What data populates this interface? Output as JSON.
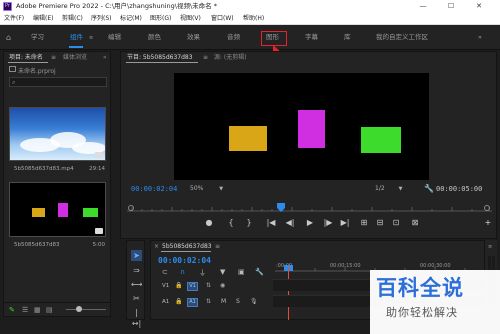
{
  "titlebar": {
    "app_logo": "Pr",
    "title": "Adobe Premiere Pro 2022 - C:\\用户\\zhangshuning\\视频\\未命名 *",
    "minimize": "—",
    "maximize": "☐",
    "close": "✕"
  },
  "menubar": {
    "items": [
      "文件(F)",
      "编辑(E)",
      "剪辑(C)",
      "序列(S)",
      "标记(M)",
      "图形(G)",
      "视图(V)",
      "窗口(W)",
      "帮助(H)"
    ]
  },
  "workspaces": {
    "tabs": [
      "学习",
      "组件",
      "编辑",
      "颜色",
      "效果",
      "音频",
      "图形",
      "字幕",
      "库",
      "我的自定义工作区"
    ],
    "active_index": 1,
    "highlighted_index": 6,
    "more": "»"
  },
  "project_panel": {
    "tab_project": "项目: 未命名",
    "tab_media": "媒体浏览",
    "more": "»",
    "menu": "≡",
    "file_name": "未命名.prproj",
    "clips": [
      {
        "name": "5b5085d637d83.mp4",
        "duration": "29:14"
      },
      {
        "name": "5b5085d637d83",
        "duration": "5:00"
      }
    ],
    "icons": [
      "pencil-icon",
      "list-view-icon",
      "icon-view-icon",
      "freeform-view-icon",
      "zoom-slider"
    ]
  },
  "program_panel": {
    "tab_program": "节目: 5b5085d637d83",
    "tab_menu": "≡",
    "tab_source": "源: (无剪辑)",
    "timecode_current": "00:00:02:04",
    "zoom": "50%",
    "resolution": "1/2",
    "timecode_duration": "00:00:05:00",
    "shapes": [
      {
        "name": "orange-rectangle",
        "color": "#d8a616"
      },
      {
        "name": "magenta-rectangle",
        "color": "#cf2fe0"
      },
      {
        "name": "green-rectangle",
        "color": "#3ddc2c"
      }
    ],
    "transport": [
      "●",
      "{",
      "}",
      "|◀",
      "◀|",
      "▶",
      "|▶",
      "▶|",
      "⊞",
      "⊟",
      "⊡",
      "⊠"
    ]
  },
  "timeline_panel": {
    "tab_close": "×",
    "tab_name": "5b5085d637d83",
    "tab_menu": "≡",
    "timecode": "00:00:02:04",
    "ruler_labels": [
      ":00:00",
      "00:00:15:00",
      "00:00:30:00"
    ],
    "tracks": [
      {
        "name": "V1",
        "target": "V1"
      },
      {
        "name": "A1",
        "target": "A1"
      }
    ],
    "letter_m": "M",
    "letter_s": "S"
  },
  "tools": [
    "selection-tool",
    "track-select-tool",
    "ripple-edit-tool",
    "razor-tool",
    "slip-tool"
  ],
  "watermark": {
    "title": "百科全说",
    "subtitle": "助你轻松解决"
  },
  "colors": {
    "accent": "#2d8ceb",
    "highlight": "#e8212a",
    "panel_bg": "#232323"
  }
}
